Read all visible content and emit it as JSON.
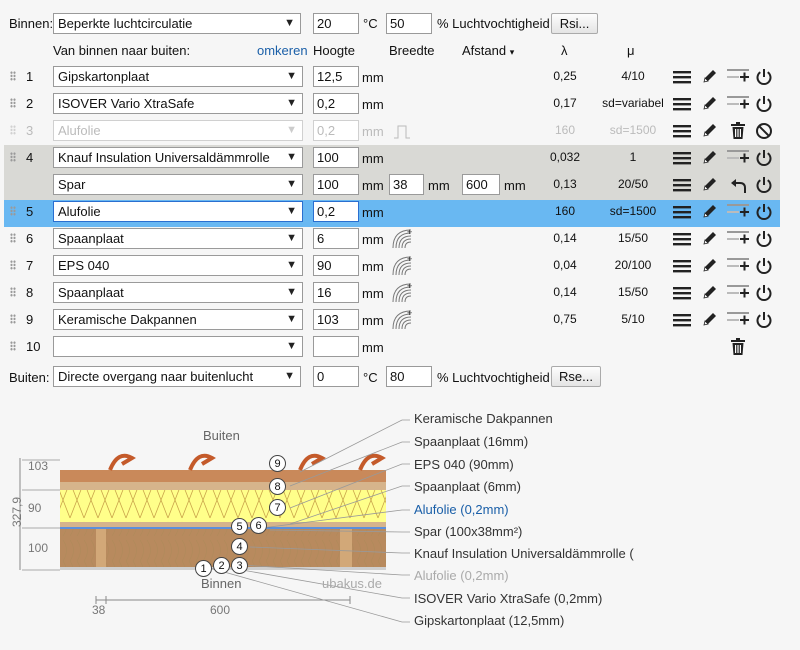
{
  "header": {
    "inside_label": "Binnen:",
    "inside_value": "Beperkte luchtcirculatie",
    "inside_temp": "20",
    "temp_unit": "°C",
    "inside_humidity": "50",
    "humidity_unit": "% Luchtvochtigheid",
    "rsi_button": "Rsi..."
  },
  "columns": {
    "layers_label": "Van binnen naar buiten:",
    "reverse_link": "omkeren",
    "height": "Hoogte",
    "width": "Breedte",
    "distance": "Afstand",
    "distance_arrow": "▾",
    "lambda": "λ",
    "mu": "μ"
  },
  "unit_mm": "mm",
  "layers": [
    {
      "num": "1",
      "material": "Gipskartonplaat",
      "height": "12,5",
      "lambda": "0,25",
      "mu": "4/10"
    },
    {
      "num": "2",
      "material": "ISOVER Vario XtraSafe",
      "height": "0,2",
      "lambda": "0,17",
      "mu": "sd=variabel"
    },
    {
      "num": "3",
      "material": "Alufolie",
      "height": "0,2",
      "lambda": "160",
      "mu": "sd=1500"
    },
    {
      "num": "4",
      "material": "Knauf Insulation Universaldämmrolle",
      "height": "100",
      "lambda": "0,032",
      "mu": "1"
    },
    {
      "num": "",
      "material": "Spar",
      "height": "100",
      "width": "38",
      "distance": "600",
      "lambda": "0,13",
      "mu": "20/50"
    },
    {
      "num": "5",
      "material": "Alufolie",
      "height": "0,2",
      "lambda": "160",
      "mu": "sd=1500"
    },
    {
      "num": "6",
      "material": "Spaanplaat",
      "height": "6",
      "lambda": "0,14",
      "mu": "15/50"
    },
    {
      "num": "7",
      "material": "EPS 040",
      "height": "90",
      "lambda": "0,04",
      "mu": "20/100"
    },
    {
      "num": "8",
      "material": "Spaanplaat",
      "height": "16",
      "lambda": "0,14",
      "mu": "15/50"
    },
    {
      "num": "9",
      "material": "Keramische Dakpannen",
      "height": "103",
      "lambda": "0,75",
      "mu": "5/10"
    },
    {
      "num": "10",
      "material": "",
      "height": "",
      "lambda": "",
      "mu": ""
    }
  ],
  "footer": {
    "outside_label": "Buiten:",
    "outside_value": "Directe overgang naar buitenlucht",
    "outside_temp": "0",
    "temp_unit": "°C",
    "outside_humidity": "80",
    "humidity_unit": "% Luchtvochtigheid",
    "rse_button": "Rse..."
  },
  "diagram": {
    "outside": "Buiten",
    "inside": "Binnen",
    "watermark": "ubakus.de",
    "dim_total": "327,9",
    "dim_103": "103",
    "dim_90": "90",
    "dim_100": "100",
    "dim_38": "38",
    "dim_600": "600",
    "markers": [
      "1",
      "2",
      "3",
      "4",
      "5",
      "6",
      "7",
      "8",
      "9"
    ],
    "legend": [
      "Keramische Dakpannen",
      "Spaanplaat (16mm)",
      "EPS 040 (90mm)",
      "Spaanplaat (6mm)",
      "Alufolie (0,2mm)",
      "Spar (100x38mm²)",
      "Knauf Insulation Universaldämmrolle (",
      "Alufolie (0,2mm)",
      "ISOVER Vario XtraSafe (0,2mm)",
      "Gipskartonplaat (12,5mm)"
    ]
  },
  "icons": {
    "menu": "hamburger-icon",
    "edit": "pencil-icon",
    "add": "add-layer-icon",
    "power": "power-icon",
    "delete": "trash-icon",
    "disabled": "disabled-icon",
    "swap": "swap-icon",
    "wood": "wood-grain-icon"
  },
  "colors": {
    "selected_row": "#69b8f2",
    "group_row": "#d9d9d5",
    "link": "#1a5fa8"
  }
}
